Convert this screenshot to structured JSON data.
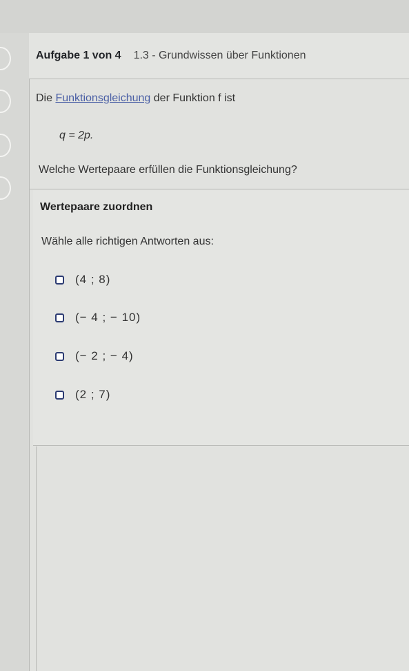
{
  "header": {
    "task_counter": "Aufgabe 1 von 4",
    "title": "1.3 - Grundwissen über Funktionen"
  },
  "question": {
    "text_prefix": "Die ",
    "link_text": "Funktionsgleichung",
    "text_suffix": " der Funktion f ist",
    "formula": "q = 2p.",
    "prompt": "Welche Wertepaare erfüllen die Funktionsgleichung?"
  },
  "answer": {
    "title": "Wertepaare zuordnen",
    "instruction": "Wähle alle richtigen Antworten aus:",
    "options": [
      {
        "label": "(4 ; 8)",
        "checked": false
      },
      {
        "label": "(− 4 ; − 10)",
        "checked": false
      },
      {
        "label": "(− 2 ; − 4)",
        "checked": false
      },
      {
        "label": "(2 ; 7)",
        "checked": false
      }
    ]
  },
  "colors": {
    "link": "#4a5fa5",
    "checkbox_border": "#2c3b72",
    "background": "#e1e2df"
  }
}
